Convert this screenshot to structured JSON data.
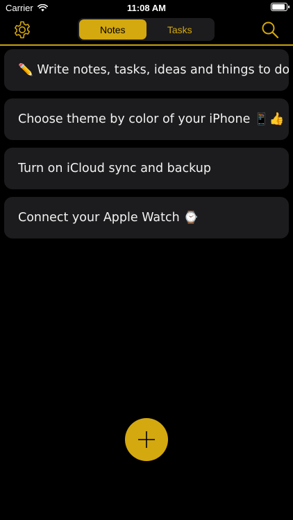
{
  "status_bar": {
    "carrier": "Carrier",
    "time": "11:08 AM"
  },
  "nav": {
    "tabs": [
      {
        "label": "Notes",
        "active": true
      },
      {
        "label": "Tasks",
        "active": false
      }
    ],
    "icons": [
      "gear-icon",
      "search-icon"
    ]
  },
  "notes": [
    {
      "text": "✏️ Write notes, tasks, ideas and things to do"
    },
    {
      "text": "Choose theme by color of your iPhone 📱👍"
    },
    {
      "text": "Turn on iCloud sync and backup"
    },
    {
      "text": "Connect your Apple Watch ⌚"
    }
  ],
  "add_button": {
    "icon": "plus-icon"
  },
  "colors": {
    "accent": "#d4a80f",
    "background": "#000000",
    "card": "#1c1c1e"
  }
}
